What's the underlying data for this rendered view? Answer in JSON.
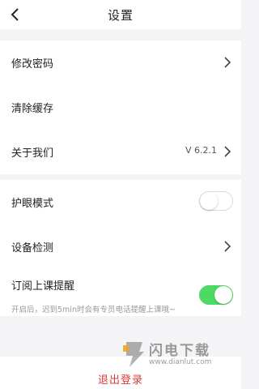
{
  "header": {
    "title": "设置"
  },
  "account": {
    "change_password": "修改密码",
    "clear_cache": "清除缓存",
    "about_us": "关于我们",
    "version": "V 6.2.1"
  },
  "preferences": {
    "eye_mode": "护眼模式",
    "eye_mode_on": false,
    "device_check": "设备检测",
    "class_reminder": "订阅上课提醒",
    "class_reminder_on": true,
    "class_reminder_desc": "开启后，迟到5min时会有专员电话提醒上课哦~"
  },
  "logout": {
    "label": "退出登录"
  },
  "watermark": {
    "title": "闪电下载",
    "url": "www.dianlut.com"
  },
  "colors": {
    "toggle_on": "#4cd964",
    "logout_text": "#d93a3a",
    "background": "#f4f4f6"
  },
  "icons": {
    "back": "chevron-left-icon",
    "row_arrow": "chevron-right-icon"
  }
}
